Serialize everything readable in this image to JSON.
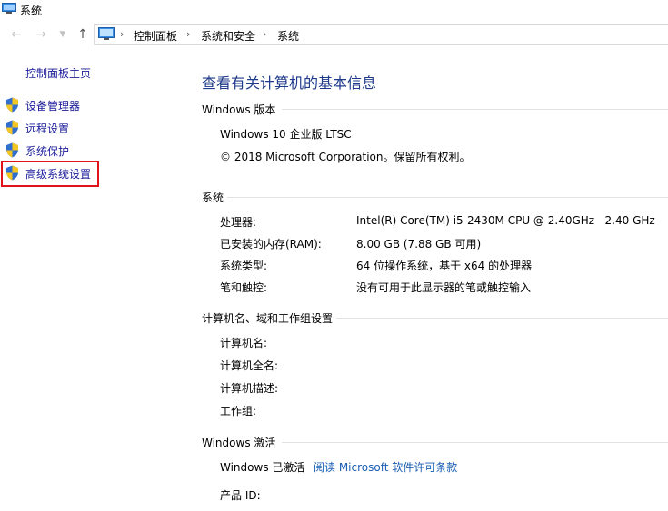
{
  "window": {
    "title": "系统"
  },
  "address": {
    "crumbs": [
      "控制面板",
      "系统和安全",
      "系统"
    ]
  },
  "sidebar": {
    "home": "控制面板主页",
    "items": [
      "设备管理器",
      "远程设置",
      "系统保护",
      "高级系统设置"
    ]
  },
  "main": {
    "title": "查看有关计算机的基本信息",
    "edition": {
      "heading": "Windows 版本",
      "name": "Windows 10 企业版 LTSC",
      "copyright": "© 2018 Microsoft Corporation。保留所有权利。"
    },
    "system": {
      "heading": "系统",
      "rows": [
        {
          "label": "处理器:",
          "value": "Intel(R) Core(TM) i5-2430M CPU @ 2.40GHz   2.40 GHz"
        },
        {
          "label": "已安装的内存(RAM):",
          "value": "8.00 GB (7.88 GB 可用)"
        },
        {
          "label": "系统类型:",
          "value": "64 位操作系统，基于 x64 的处理器"
        },
        {
          "label": "笔和触控:",
          "value": "没有可用于此显示器的笔或触控输入"
        }
      ]
    },
    "computer": {
      "heading": "计算机名、域和工作组设置",
      "rows": [
        "计算机名:",
        "计算机全名:",
        "计算机描述:",
        "工作组:"
      ]
    },
    "activation": {
      "heading": "Windows 激活",
      "status": "Windows 已激活",
      "license_link": "阅读 Microsoft 软件许可条款",
      "product_id_label": "产品 ID:"
    }
  },
  "colors": {
    "link": "#1a5fb4",
    "title": "#1e3a8a",
    "highlight": "#e0121a"
  }
}
